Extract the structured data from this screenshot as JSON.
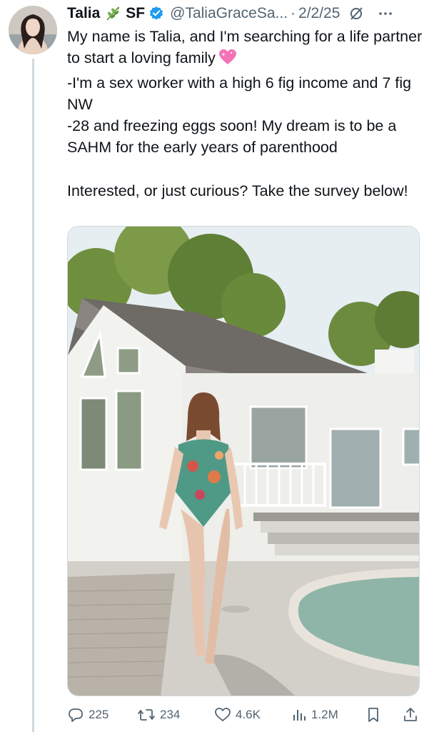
{
  "tweet": {
    "display_name": "Talia",
    "location_emoji": "herb-emoji",
    "location": "SF",
    "verified": true,
    "handle": "@TaliaGraceSa...",
    "separator": "·",
    "date": "2/2/25",
    "text": {
      "line1": "My name is Talia, and I'm searching for a life partner to start a loving family",
      "line2": "-I'm a sex worker with a high 6 fig income and 7 fig NW",
      "line3": "-28 and freezing eggs soon! My dream is to be a SAHM for the early years of parenthood",
      "line4": "Interested, or just curious? Take the survey below!"
    }
  },
  "actions": {
    "replies": "225",
    "reposts": "234",
    "likes": "4.6K",
    "views": "1.2M"
  },
  "colors": {
    "verified": "#1d9bf0",
    "secondary_text": "#536471",
    "heart_emoji": "#f472b6"
  },
  "icons": [
    "herb-emoji",
    "verified-badge-icon",
    "grok-icon",
    "more-icon",
    "reply-icon",
    "repost-icon",
    "like-icon",
    "views-icon",
    "bookmark-icon",
    "share-icon"
  ]
}
